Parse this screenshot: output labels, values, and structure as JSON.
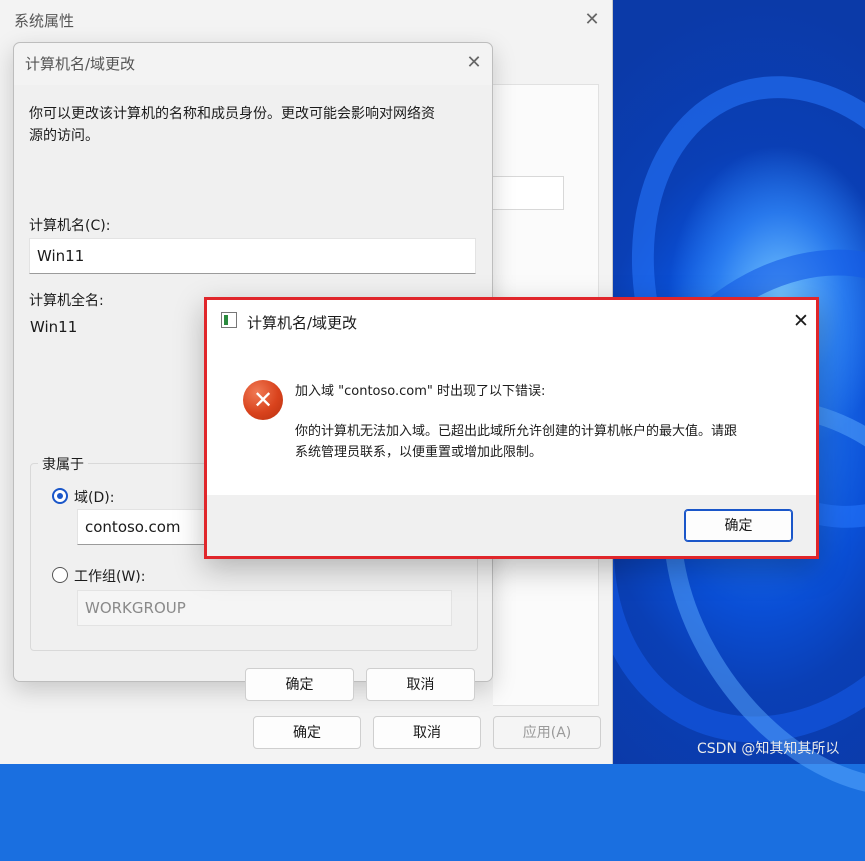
{
  "system_properties": {
    "title": "系统属性",
    "buttons": {
      "ok": "确定",
      "cancel": "取消",
      "apply": "应用(A)"
    }
  },
  "computer_name_dialog": {
    "title": "计算机名/域更改",
    "description_line1": "你可以更改该计算机的名称和成员身份。更改可能会影响对网络资",
    "description_line2": "源的访问。",
    "computer_name_label": "计算机名(C):",
    "computer_name_value": "Win11",
    "full_name_label": "计算机全名:",
    "full_name_value": "Win11",
    "member_of_label": "隶属于",
    "domain_label": "域(D):",
    "domain_value": "contoso.com",
    "workgroup_label": "工作组(W):",
    "workgroup_value": "WORKGROUP",
    "buttons": {
      "ok": "确定",
      "cancel": "取消"
    }
  },
  "error_dialog": {
    "title": "计算机名/域更改",
    "message_line1": "加入域 \"contoso.com\" 时出现了以下错误:",
    "message_line2": "你的计算机无法加入域。已超出此域所允许创建的计算机帐户的最大值。请跟",
    "message_line3": "系统管理员联系，以便重置或增加此限制。",
    "ok_button": "确定"
  },
  "watermark": "CSDN @知其知其所以",
  "colors": {
    "error_border": "#e0262b",
    "accent": "#1a56c9",
    "error_icon": "#d9431d"
  },
  "icons": {
    "close": "close-icon",
    "error": "error-icon",
    "app": "app-window-icon"
  }
}
